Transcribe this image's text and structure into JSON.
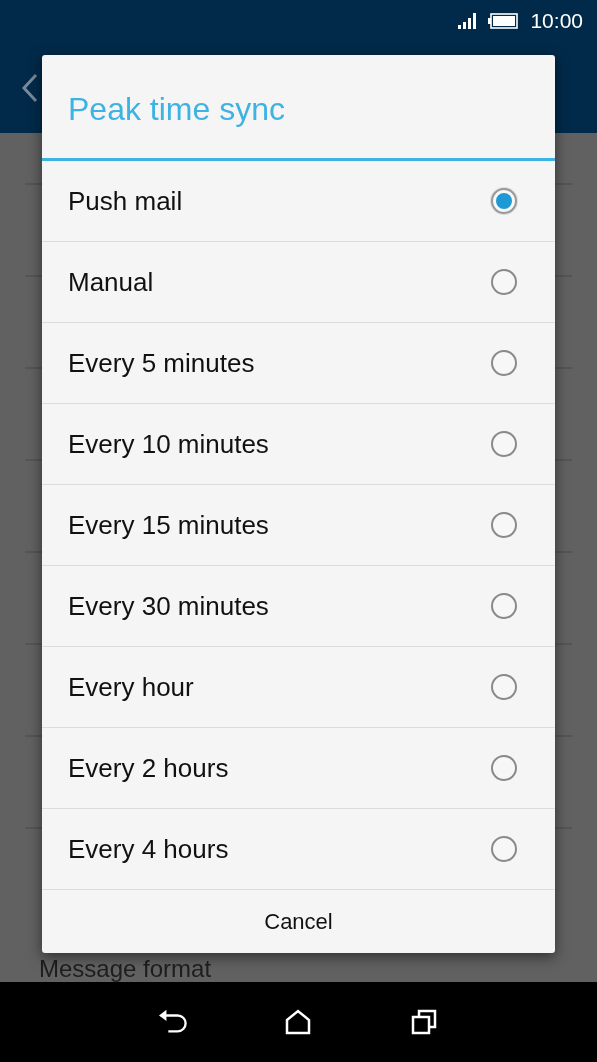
{
  "status_bar": {
    "time": "10:00"
  },
  "background": {
    "last_item": "Message format"
  },
  "dialog": {
    "title": "Peak time sync",
    "options": [
      {
        "label": "Push mail",
        "selected": true
      },
      {
        "label": "Manual",
        "selected": false
      },
      {
        "label": "Every 5 minutes",
        "selected": false
      },
      {
        "label": "Every 10 minutes",
        "selected": false
      },
      {
        "label": "Every 15 minutes",
        "selected": false
      },
      {
        "label": "Every 30 minutes",
        "selected": false
      },
      {
        "label": "Every hour",
        "selected": false
      },
      {
        "label": "Every 2 hours",
        "selected": false
      },
      {
        "label": "Every 4 hours",
        "selected": false
      }
    ],
    "cancel": "Cancel"
  }
}
